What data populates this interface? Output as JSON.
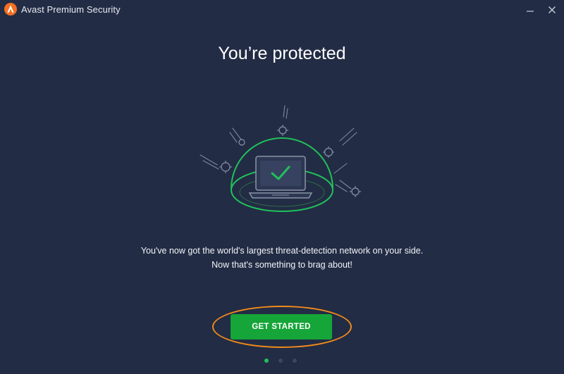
{
  "app": {
    "title": "Avast Premium Security",
    "brand_color": "#f36f21"
  },
  "window_controls": {
    "minimize_icon": "minimize-icon",
    "close_icon": "close-icon"
  },
  "main": {
    "headline": "You’re protected",
    "description_line1": "You've now got the world's largest threat-detection network on your side.",
    "description_line2": "Now that's something to brag about!",
    "cta_label": "GET STARTED",
    "cta_color": "#16a538",
    "highlight_color": "#f08a1c"
  },
  "illustration": {
    "icon": "protected-laptop-dome-icon",
    "accent_color": "#21c05a"
  },
  "pager": {
    "total": 3,
    "active_index": 0
  }
}
